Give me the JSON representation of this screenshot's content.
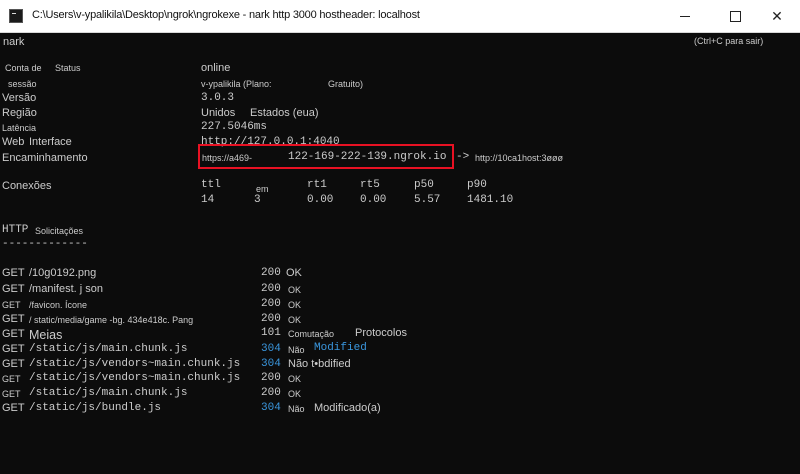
{
  "window": {
    "title": "C:\\Users\\v-ypalikila\\Desktop\\ngrok\\ngrokexe - nark http 3000 hostheader: localhost"
  },
  "console": {
    "app_name": "nark",
    "quit_hint": "(Ctrl+C para sair)",
    "status_label": "Status",
    "account_label_1": "Conta de",
    "account_label_2": "sessão",
    "session_status": "online",
    "account_value_1": "v-ypalikila (Plano:",
    "account_value_2": "Gratuito)",
    "version_label": "Versão",
    "version_value": "3.0.3",
    "region_label": "Região",
    "region_value_1": "Unidos",
    "region_value_2": "Estados (eua)",
    "latency_label": "Latência",
    "latency_value": "227.5046ms",
    "web_interface_label_1": "Web",
    "web_interface_label_2": "Interface",
    "web_interface_value": "http://127.0.0.1:4040",
    "forwarding_label": "Encaminhamento",
    "forwarding_url_1": "https://a469-",
    "forwarding_url_2": "122-169-222-139.ngrok.io",
    "forwarding_arrow": "->",
    "forwarding_target": "http://10ca1host:3øøø",
    "connections_label": "Conexões",
    "connections_headers": [
      "ttl",
      "em",
      "rt1",
      "rt5",
      "p50",
      "p90"
    ],
    "connections_values": [
      "14",
      "3",
      "0.00",
      "0.00",
      "5.57",
      "1481.10"
    ],
    "http_label": "HTTP",
    "requests_label": "Solicitações",
    "separator": "-------------"
  },
  "requests": [
    {
      "method": "GET",
      "path": "/10g0192.png",
      "code": "200",
      "status": "OK"
    },
    {
      "method": "GET",
      "path": "/manifest. j son",
      "code": "200",
      "status": "OK"
    },
    {
      "method": "GET",
      "path": "/favicon. Ícone",
      "code": "200",
      "status": "OK"
    },
    {
      "method": "GET",
      "path": "/ static/media/game -bg. 434e418c. Pang",
      "code": "200",
      "status": "OK"
    },
    {
      "method": "GET",
      "path": "Meias",
      "code": "101",
      "status": "Comutação",
      "status2": "Protocolos"
    },
    {
      "method": "GET",
      "path": "/static/js/main.chunk.js",
      "code": "304",
      "status": "Não",
      "status2": "Modified"
    },
    {
      "method": "GET",
      "path": "/static/js/vendors~main.chunk.js",
      "code": "304",
      "status": "Não t•bdified"
    },
    {
      "method": "GET",
      "path": "/static/js/vendors~main.chunk.js",
      "code": "200",
      "status": "OK"
    },
    {
      "method": "GET",
      "path": "/static/js/main.chunk.js",
      "code": "200",
      "status": "OK"
    },
    {
      "method": "GET",
      "path": "/static/js/bundle.js",
      "code": "304",
      "status": "Não",
      "status2": "Modificado(a)"
    }
  ],
  "colors": {
    "background": "#0c0c0c",
    "text": "#cccccc",
    "highlight_box": "#e81123",
    "modified_blue": "#3a96dd"
  },
  "icons": {
    "app": "console-app-icon",
    "minimize": "minimize-icon",
    "maximize": "maximize-icon",
    "close": "close-icon"
  }
}
